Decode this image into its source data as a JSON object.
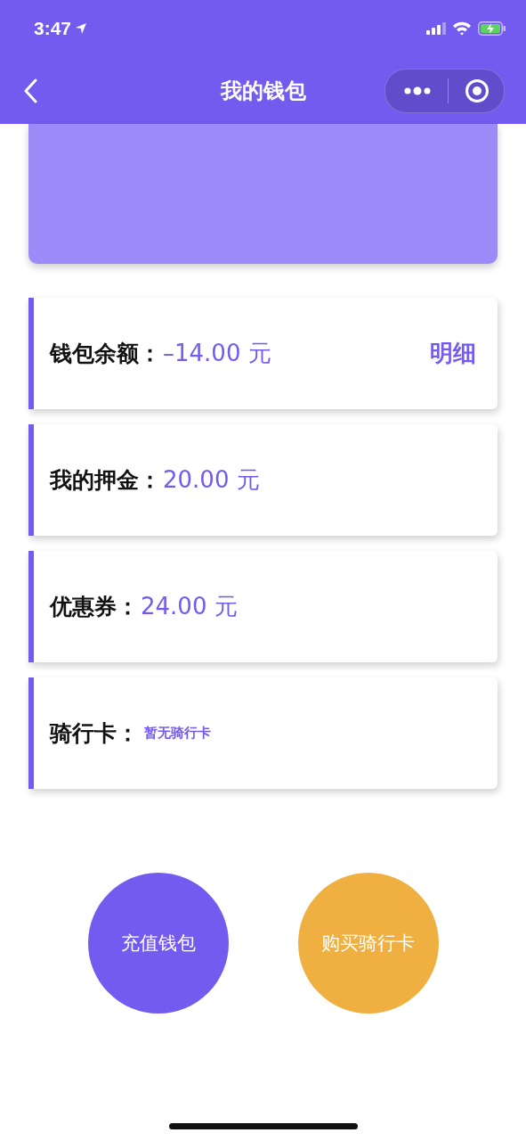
{
  "status_bar": {
    "time": "3:47"
  },
  "nav": {
    "title": "我的钱包"
  },
  "items": [
    {
      "label": "钱包余额：",
      "value": "–14.00 元",
      "kind": "amount",
      "link": "明细"
    },
    {
      "label": "我的押金：",
      "value": "20.00 元",
      "kind": "amount"
    },
    {
      "label": "优惠券：",
      "value": "24.00 元",
      "kind": "amount"
    },
    {
      "label": "骑行卡：",
      "value": "暂无骑行卡",
      "kind": "note"
    }
  ],
  "buttons": [
    {
      "label": "充值钱包",
      "color": "#735bf0"
    },
    {
      "label": "购买骑行卡",
      "color": "#efb041"
    }
  ]
}
